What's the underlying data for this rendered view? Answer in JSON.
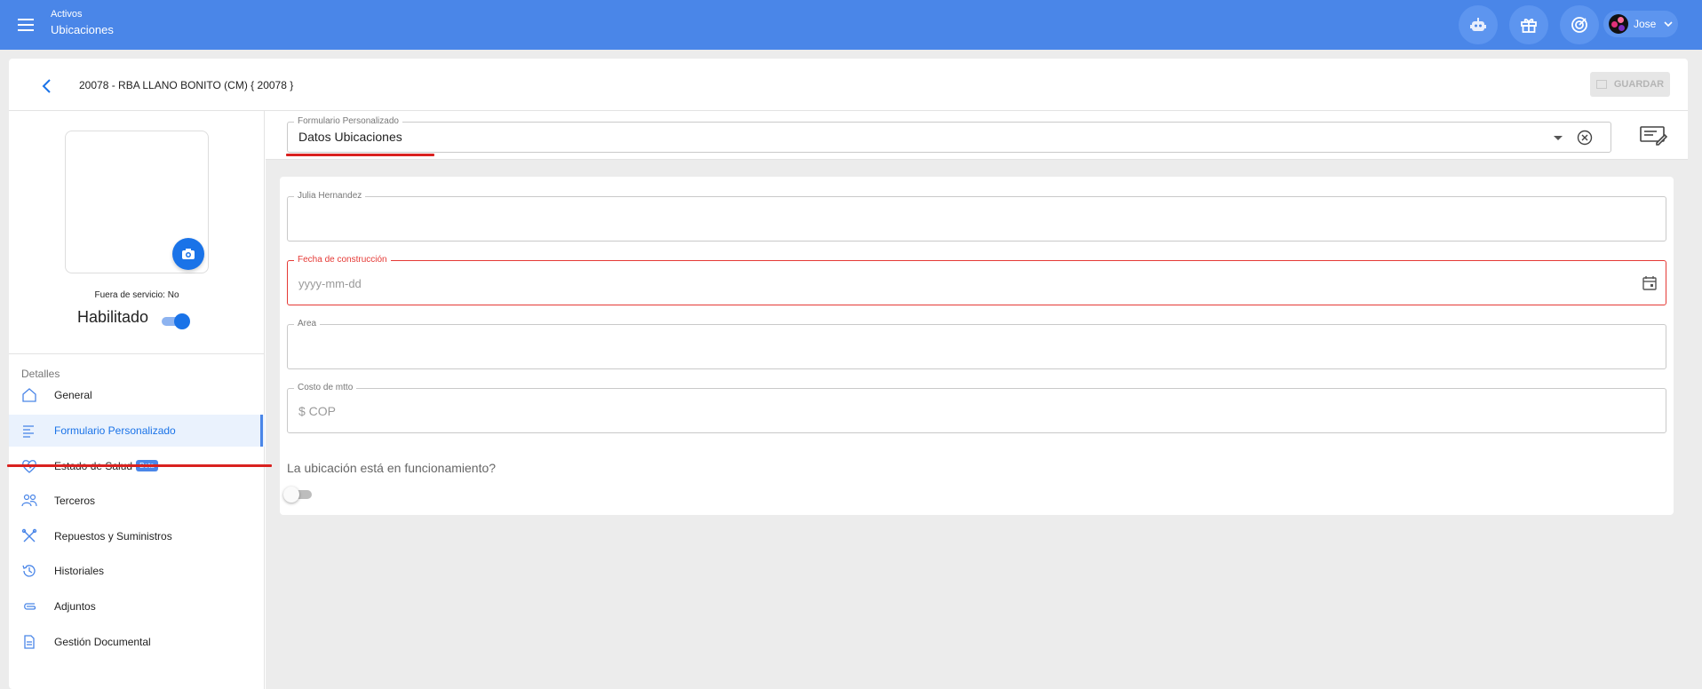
{
  "header": {
    "section": "Activos",
    "page": "Ubicaciones",
    "user_name": "Jose",
    "icons": [
      "menu-icon",
      "robot-icon",
      "gift-icon",
      "target-icon",
      "chevron-down-icon"
    ]
  },
  "asset": {
    "title": "20078 - RBA LLANO BONITO (CM) { 20078 }",
    "save_label": "GUARDAR"
  },
  "left_panel": {
    "out_of_service": "Fuera de servicio: No",
    "enabled_label": "Habilitado",
    "enabled_state": true,
    "details_label": "Detalles",
    "nav": [
      {
        "label": "General",
        "icon": "home-icon"
      },
      {
        "label": "Formulario Personalizado",
        "icon": "form-list-icon",
        "active": true
      },
      {
        "label": "Estado de Salud",
        "icon": "heart-pulse-icon",
        "badge": "Beta"
      },
      {
        "label": "Terceros",
        "icon": "people-icon"
      },
      {
        "label": "Repuestos y Suministros",
        "icon": "tools-icon"
      },
      {
        "label": "Historiales",
        "icon": "history-icon"
      },
      {
        "label": "Adjuntos",
        "icon": "paperclip-icon"
      },
      {
        "label": "Gestión Documental",
        "icon": "document-icon"
      }
    ]
  },
  "form": {
    "selector_label": "Formulario Personalizado",
    "selector_value": "Datos Ubicaciones",
    "fields": [
      {
        "label": "Julia Hernandez",
        "value": ""
      },
      {
        "label": "Fecha de construcción",
        "placeholder": "yyyy-mm-dd",
        "error": true
      },
      {
        "label": "Area",
        "value": ""
      },
      {
        "label": "Costo de mtto",
        "placeholder": "$ COP"
      }
    ],
    "question": "La ubicación está en funcionamiento?",
    "question_state": false
  },
  "colors": {
    "topbar": "#4a86e8",
    "accent": "#1a73e8",
    "error": "#e53935",
    "annotation_underline": "#d9211f"
  }
}
